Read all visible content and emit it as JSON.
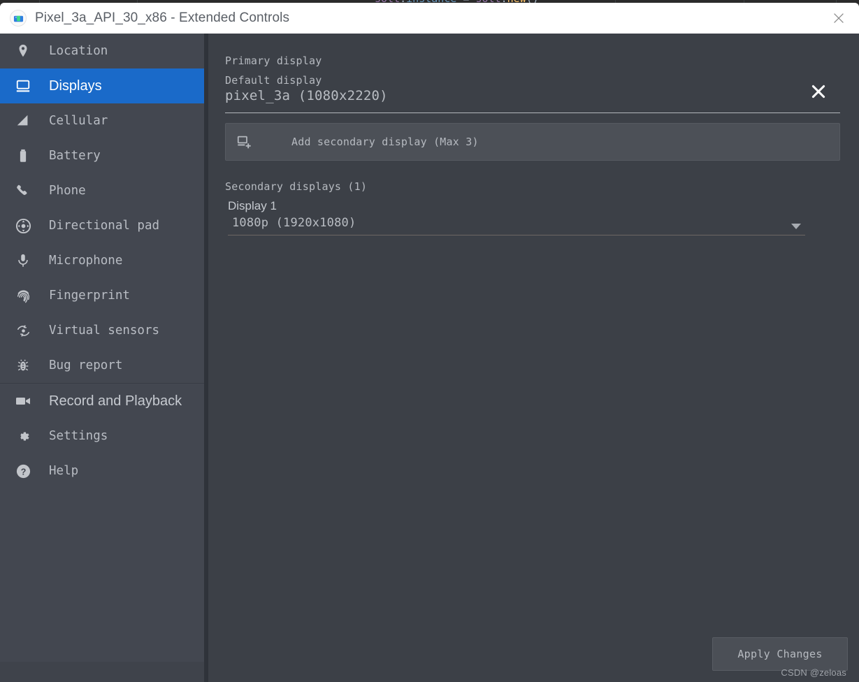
{
  "window": {
    "title": "Pixel_3a_API_30_x86 - Extended Controls",
    "app_icon": "android-emulator-icon",
    "close_label": "✕"
  },
  "background_code": {
    "text": "solt.instance = solt.new()"
  },
  "sidebar": {
    "items": [
      {
        "label": "Location",
        "icon": "location-pin-icon",
        "selected": false,
        "style": "mono"
      },
      {
        "label": "Displays",
        "icon": "monitor-icon",
        "selected": true,
        "style": "sans"
      },
      {
        "label": "Cellular",
        "icon": "signal-bars-icon",
        "selected": false,
        "style": "mono"
      },
      {
        "label": "Battery",
        "icon": "battery-icon",
        "selected": false,
        "style": "mono"
      },
      {
        "label": "Phone",
        "icon": "phone-handset-icon",
        "selected": false,
        "style": "mono"
      },
      {
        "label": "Directional pad",
        "icon": "dpad-icon",
        "selected": false,
        "style": "mono"
      },
      {
        "label": "Microphone",
        "icon": "microphone-icon",
        "selected": false,
        "style": "mono"
      },
      {
        "label": "Fingerprint",
        "icon": "fingerprint-icon",
        "selected": false,
        "style": "mono"
      },
      {
        "label": "Virtual sensors",
        "icon": "rotation-sensor-icon",
        "selected": false,
        "style": "mono"
      },
      {
        "label": "Bug report",
        "icon": "bug-icon",
        "selected": false,
        "style": "mono"
      }
    ],
    "footer_items": [
      {
        "label": "Record and Playback",
        "icon": "video-camera-icon",
        "style": "sans"
      },
      {
        "label": "Settings",
        "icon": "gear-icon",
        "style": "mono"
      },
      {
        "label": "Help",
        "icon": "question-mark-icon",
        "style": "mono"
      }
    ]
  },
  "main": {
    "primary_display_label": "Primary display",
    "default_display_label": "Default display",
    "default_display_value": "pixel_3a (1080x2220)",
    "add_secondary_label": "Add secondary display (Max 3)",
    "add_secondary_icon": "monitor-plus-icon",
    "secondary_displays_label": "Secondary displays (1)",
    "displays": [
      {
        "name": "Display 1",
        "resolution": "1080p (1920x1080)",
        "remove_label": "✕"
      }
    ],
    "apply_button_label": "Apply Changes"
  },
  "watermark": "CSDN @zeloas",
  "colors": {
    "accent_blue": "#1a6ac9",
    "sidebar_bg": "#434750",
    "panel_bg": "#3c4047",
    "titlebar_bg": "#ffffff",
    "text_muted": "#b6bac0"
  }
}
